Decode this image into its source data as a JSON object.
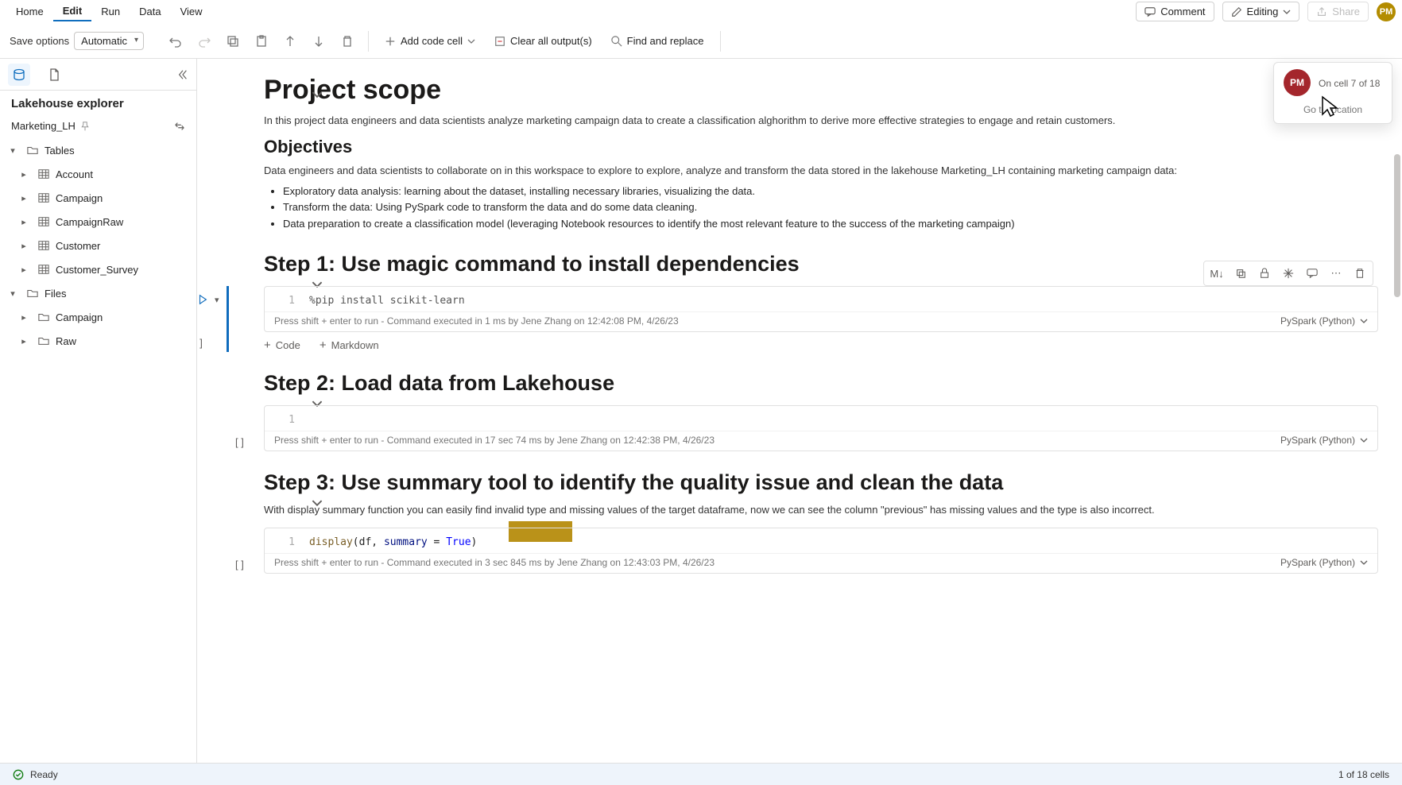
{
  "menu": {
    "home": "Home",
    "edit": "Edit",
    "run": "Run",
    "data": "Data",
    "view": "View"
  },
  "topright": {
    "comment": "Comment",
    "editing": "Editing",
    "share": "Share",
    "avatar_initials": "PM"
  },
  "toolbar": {
    "save_options_label": "Save options",
    "save_options_value": "Automatic",
    "add_code": "Add code cell",
    "clear_output": "Clear all output(s)",
    "find_replace": "Find and replace"
  },
  "sidebar": {
    "title": "Lakehouse explorer",
    "lakehouse_name": "Marketing_LH",
    "tables_label": "Tables",
    "files_label": "Files",
    "tables": [
      "Account",
      "Campaign",
      "CampaignRaw",
      "Customer",
      "Customer_Survey"
    ],
    "files": [
      "Campaign",
      "Raw"
    ]
  },
  "doc": {
    "scope_title": "Project scope",
    "scope_para": "In this project data engineers and data scientists analyze marketing campaign data to create a classification alghorithm to derive more effective strategies to engage and retain customers.",
    "objectives_title": "Objectives",
    "objectives_intro": "Data engineers and data scientists to collaborate on in this workspace to explore to explore, analyze and transform the data stored in the lakehouse Marketing_LH containing marketing campaign data:",
    "objectives": [
      "Exploratory data analysis: learning about the dataset, installing necessary libraries, visualizing the data.",
      "Transform the data: Using PySpark code to transform the data and do some data cleaning.",
      "Data preparation to create a classification model (leveraging Notebook resources to identify the most relevant feature to the success of the marketing campaign)"
    ],
    "step1_title": "Step 1: Use magic command to install dependencies",
    "step1_code": "%pip install scikit-learn",
    "step1_hint": "Press shift + enter to run",
    "step1_status": "- Command executed in 1 ms by Jene Zhang on 12:42:08 PM, 4/26/23",
    "step2_title": "Step 2: Load data from Lakehouse",
    "step2_status": "- Command executed in 17 sec 74 ms by Jene Zhang on 12:42:38 PM, 4/26/23",
    "step3_title": "Step 3: Use summary tool to identify the quality issue and clean the data",
    "step3_para": "With display summary function you can easily find invalid type and missing values of the target dataframe, now we can see the column \"previous\" has missing values and the type is also incorrect.",
    "step3_code_display": "display",
    "step3_code_rest": "(df, ",
    "step3_code_param": "summary",
    "step3_code_eq": " = ",
    "step3_code_true": "True",
    "step3_code_close": ")",
    "step3_status": "- Command executed in 3 sec 845 ms by Jene Zhang on 12:43:03 PM, 4/26/23",
    "kernel": "PySpark (Python)",
    "md_marker": "M↓",
    "add_code": "Code",
    "add_markdown": "Markdown",
    "line1": "1",
    "brackets": "[ ]"
  },
  "presence": {
    "initials": "PM",
    "status": "On cell 7 of 18",
    "link": "Go to location"
  },
  "status": {
    "ready": "Ready",
    "cells": "1 of 18 cells"
  }
}
